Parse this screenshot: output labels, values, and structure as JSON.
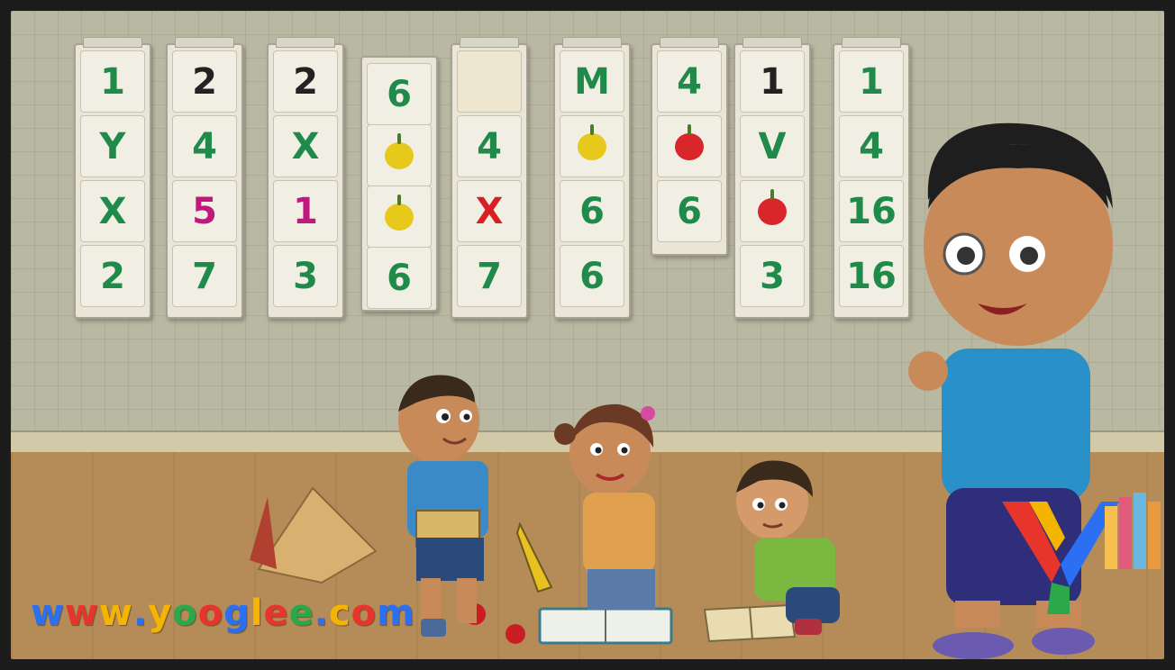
{
  "posters": [
    {
      "cells": [
        "1",
        "Y",
        "X",
        "2"
      ]
    },
    {
      "cells": [
        "2",
        "4",
        "5",
        "7"
      ]
    },
    {
      "cells": [
        "2",
        "X",
        "1",
        "3"
      ]
    },
    {
      "cells": [
        "6",
        "",
        "",
        "6"
      ]
    },
    {
      "cells": [
        "",
        "4",
        "X",
        "7"
      ]
    },
    {
      "cells": [
        "M",
        "",
        "6",
        "6"
      ]
    },
    {
      "cells": [
        "4",
        "",
        "6"
      ]
    },
    {
      "cells": [
        "1",
        "V",
        "",
        "3"
      ]
    },
    {
      "cells": [
        "1",
        "4",
        "16",
        "16"
      ]
    }
  ],
  "watermark": {
    "text": "www.yooglee.com",
    "colors": [
      "#2b6ff2",
      "#e8352b",
      "#f5b400",
      "#2b6ff2",
      "#f5b400",
      "#2ba84a",
      "#e8352b",
      "#2b6ff2",
      "#f5b400",
      "#e8352b",
      "#2ba84a",
      "#2b6ff2",
      "#f5b400",
      "#e8352b",
      "#2b6ff2"
    ]
  }
}
